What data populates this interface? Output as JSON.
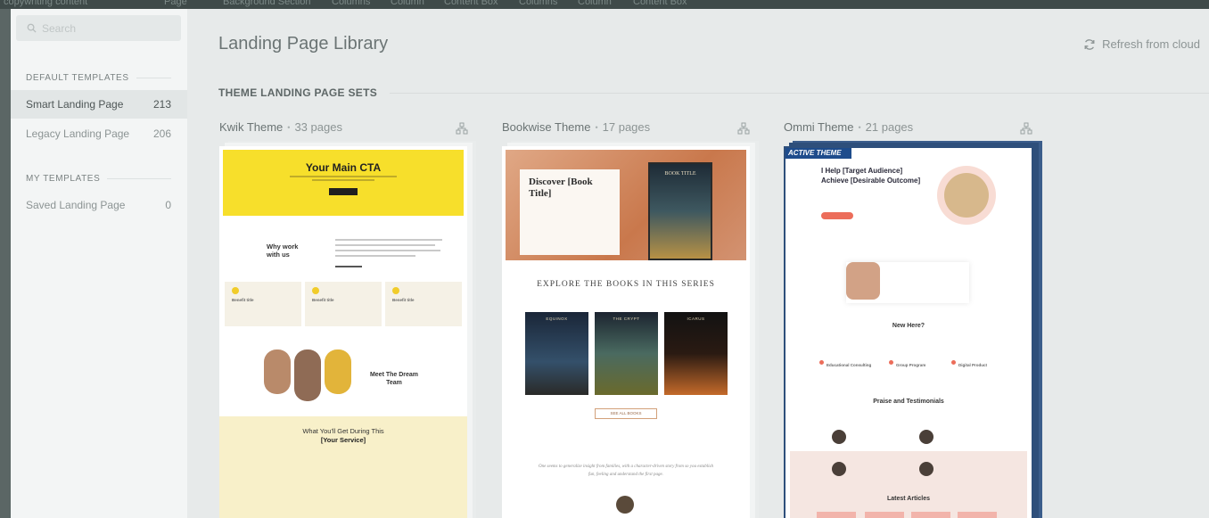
{
  "modal": {
    "search": {
      "placeholder": "Search"
    },
    "sidebar": {
      "default_title": "DEFAULT TEMPLATES",
      "default_items": [
        {
          "label": "Smart Landing Page",
          "count": "213",
          "active": true
        },
        {
          "label": "Legacy Landing Page",
          "count": "206",
          "active": false
        }
      ],
      "my_title": "MY TEMPLATES",
      "my_items": [
        {
          "label": "Saved Landing Page",
          "count": "0",
          "active": false
        }
      ]
    },
    "title": "Landing Page Library",
    "refresh_label": "Refresh from cloud",
    "sets_title": "THEME LANDING PAGE SETS",
    "themes": [
      {
        "name": "Kwik Theme",
        "pages": "33 pages"
      },
      {
        "name": "Bookwise Theme",
        "pages": "17 pages"
      },
      {
        "name": "Ommi Theme",
        "pages": "21 pages",
        "badge": "ACTIVE THEME"
      }
    ]
  },
  "previews": {
    "kwik": {
      "hero_title": "Your Main CTA",
      "why_title": "Why work with us",
      "benefit": "Benefit title",
      "meet_title": "Meet The Dream Team",
      "get_title_a": "What You'll Get During This ",
      "get_title_b": "[Your Service]"
    },
    "bookwise": {
      "hero_title": "Discover [Book Title]",
      "book_cover": "BOOK TITLE",
      "explore": "EXPLORE THE BOOKS IN THIS SERIES",
      "books": [
        "EQUINOX",
        "THE CRYPT",
        "ICARUS"
      ],
      "button": "SEE ALL BOOKS",
      "quote": "One seems to generalize insight from families, with a character-driven story from so you establish fun, feeling and understand the first page."
    },
    "ommi": {
      "headline": "I Help [Target Audience] Achieve [Desirable Outcome]",
      "new_here": "New Here?",
      "columns": [
        "Educational Consulting",
        "Group Program",
        "Digital Product"
      ],
      "praise": "Praise and Testimonials",
      "articles": "Latest Articles"
    }
  },
  "colors": {
    "active_theme": "#1e4c8c",
    "kwik_yellow": "#f7df2b",
    "ommi_accent": "#ec6d5a"
  }
}
